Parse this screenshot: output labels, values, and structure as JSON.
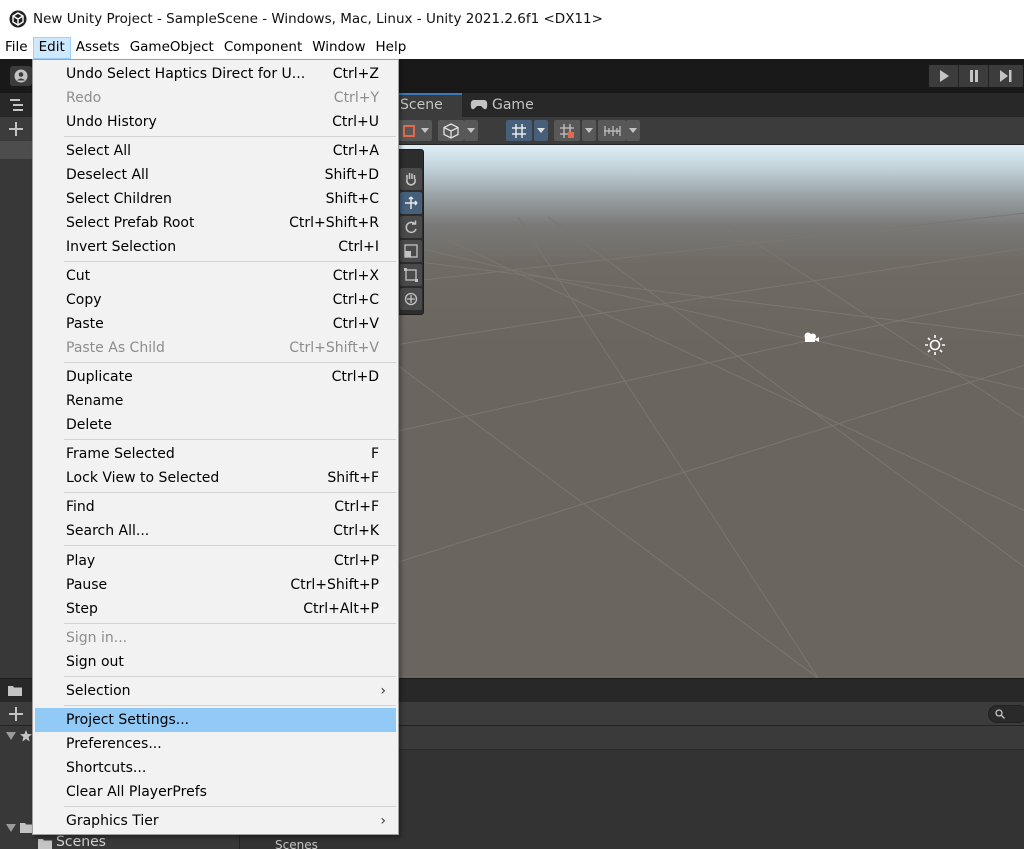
{
  "window": {
    "title": "New Unity Project - SampleScene - Windows, Mac, Linux - Unity 2021.2.6f1 <DX11>",
    "logo_icon": "unity-logo-icon"
  },
  "menubar": {
    "items": [
      "File",
      "Edit",
      "Assets",
      "GameObject",
      "Component",
      "Window",
      "Help"
    ],
    "active": "Edit"
  },
  "scene_view": {
    "tabs": {
      "scene": "Scene",
      "game": "Game"
    }
  },
  "project_panel": {
    "left_folder": "Scenes",
    "right_folder": "Scenes"
  },
  "edit_menu": {
    "items": [
      {
        "label": "Undo Select Haptics Direct for U...",
        "shortcut": "Ctrl+Z"
      },
      {
        "label": "Redo",
        "shortcut": "Ctrl+Y",
        "disabled": true
      },
      {
        "label": "Undo History",
        "shortcut": "Ctrl+U"
      },
      {
        "label": "Select All",
        "shortcut": "Ctrl+A"
      },
      {
        "label": "Deselect All",
        "shortcut": "Shift+D"
      },
      {
        "label": "Select Children",
        "shortcut": "Shift+C"
      },
      {
        "label": "Select Prefab Root",
        "shortcut": "Ctrl+Shift+R"
      },
      {
        "label": "Invert Selection",
        "shortcut": "Ctrl+I"
      },
      {
        "label": "Cut",
        "shortcut": "Ctrl+X"
      },
      {
        "label": "Copy",
        "shortcut": "Ctrl+C"
      },
      {
        "label": "Paste",
        "shortcut": "Ctrl+V"
      },
      {
        "label": "Paste As Child",
        "shortcut": "Ctrl+Shift+V",
        "disabled": true
      },
      {
        "label": "Duplicate",
        "shortcut": "Ctrl+D"
      },
      {
        "label": "Rename",
        "shortcut": ""
      },
      {
        "label": "Delete",
        "shortcut": ""
      },
      {
        "label": "Frame Selected",
        "shortcut": "F"
      },
      {
        "label": "Lock View to Selected",
        "shortcut": "Shift+F"
      },
      {
        "label": "Find",
        "shortcut": "Ctrl+F"
      },
      {
        "label": "Search All...",
        "shortcut": "Ctrl+K"
      },
      {
        "label": "Play",
        "shortcut": "Ctrl+P"
      },
      {
        "label": "Pause",
        "shortcut": "Ctrl+Shift+P"
      },
      {
        "label": "Step",
        "shortcut": "Ctrl+Alt+P"
      },
      {
        "label": "Sign in...",
        "shortcut": "",
        "disabled": true
      },
      {
        "label": "Sign out",
        "shortcut": ""
      },
      {
        "label": "Selection",
        "shortcut": "",
        "submenu": true
      },
      {
        "label": "Project Settings...",
        "shortcut": "",
        "highlighted": true
      },
      {
        "label": "Preferences...",
        "shortcut": ""
      },
      {
        "label": "Shortcuts...",
        "shortcut": ""
      },
      {
        "label": "Clear All PlayerPrefs",
        "shortcut": ""
      },
      {
        "label": "Graphics Tier",
        "shortcut": "",
        "submenu": true
      }
    ]
  },
  "colors": {
    "menu_highlight": "#91c9f7",
    "menu_bg": "#f2f2f2",
    "editor_dark": "#191919",
    "accent_blue": "#3a79bb"
  }
}
